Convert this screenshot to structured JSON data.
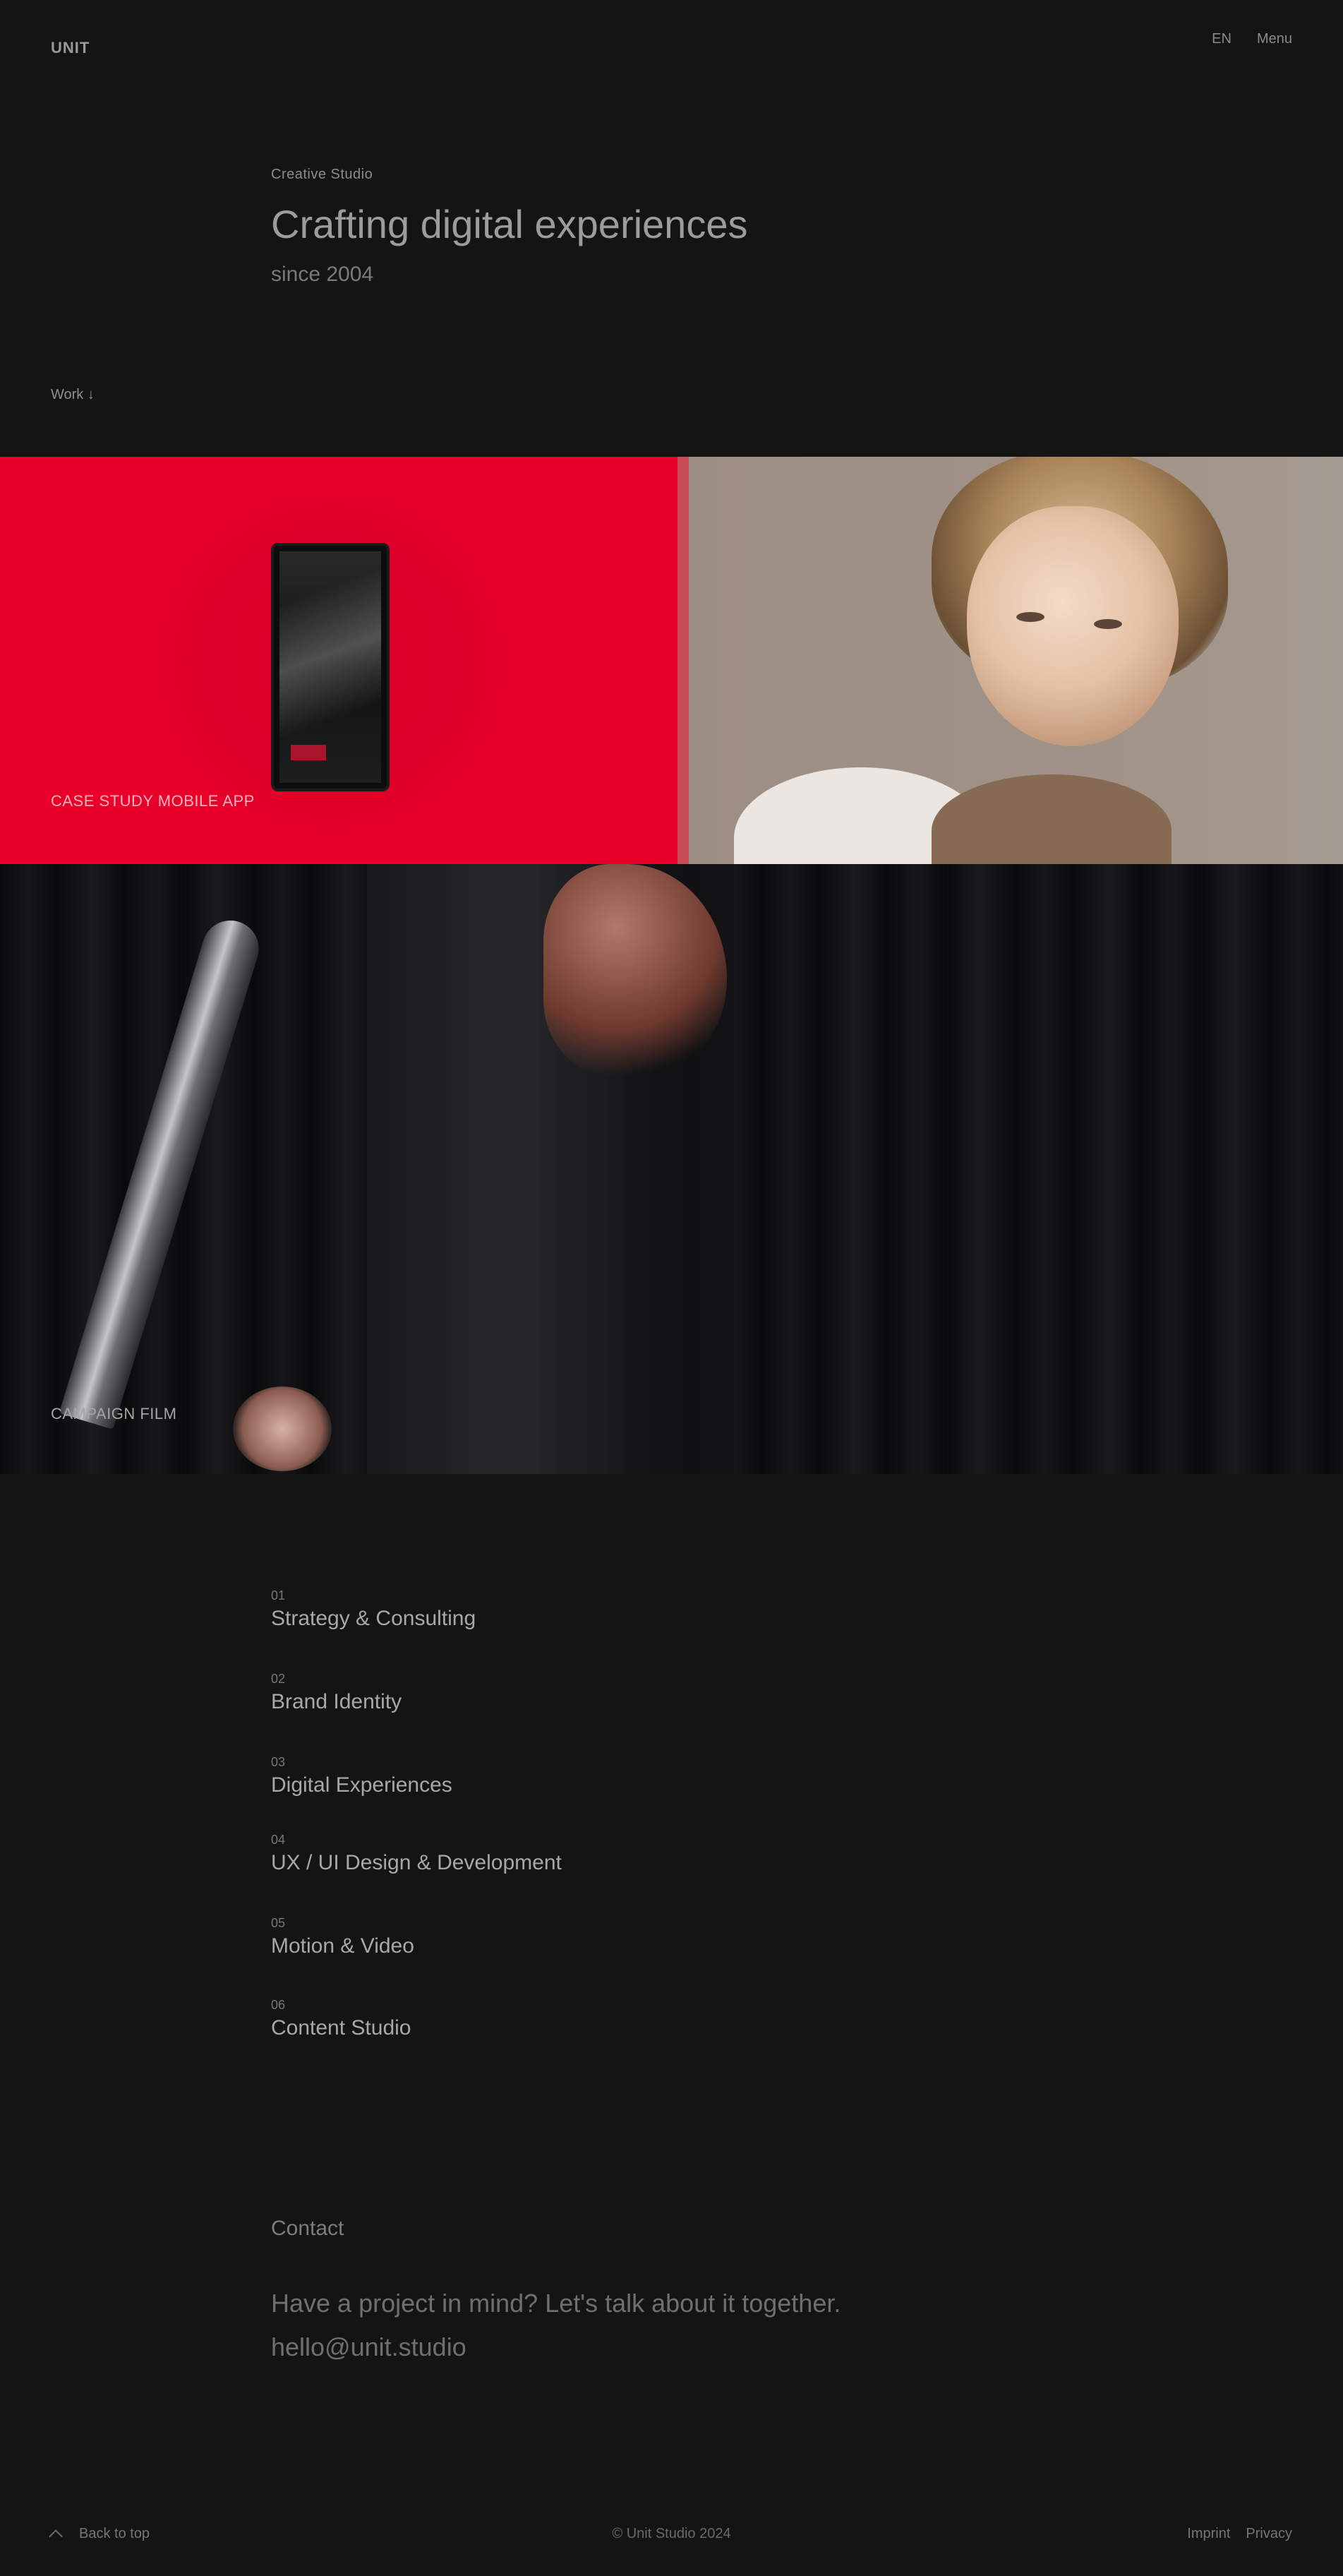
{
  "header": {
    "logo": "UNIT",
    "nav": [
      {
        "label": "EN"
      },
      {
        "label": "Menu"
      }
    ]
  },
  "intro": {
    "eyebrow": "Creative Studio",
    "heading": "Crafting digital experiences",
    "subheading": "since 2004",
    "scroll_link": "Work ↓"
  },
  "showcase": {
    "tiles": [
      {
        "label": "CASE STUDY MOBILE APP"
      },
      {
        "label": ""
      },
      {
        "label": "CAMPAIGN FILM"
      }
    ]
  },
  "services": {
    "items": [
      {
        "num": "01",
        "title": "Strategy & Consulting"
      },
      {
        "num": "02",
        "title": "Brand Identity"
      },
      {
        "num": "03",
        "title": "Digital Experiences"
      },
      {
        "num": "04",
        "title": "UX / UI Design & Development"
      },
      {
        "num": "05",
        "title": "Motion & Video"
      },
      {
        "num": "06",
        "title": "Content Studio"
      }
    ]
  },
  "contact": {
    "eyebrow": "Contact",
    "text": "Have a project in mind? Let's talk about it together. hello@unit.studio"
  },
  "footer": {
    "left_label": "Back to top",
    "copyright": "© Unit Studio 2024",
    "right_links": [
      {
        "label": "Imprint"
      },
      {
        "label": "Privacy"
      }
    ]
  },
  "colors": {
    "background": "#141415",
    "accent_red": "#e8002a",
    "text_primary": "#a8a8a8",
    "text_muted": "#7a7a7a"
  }
}
